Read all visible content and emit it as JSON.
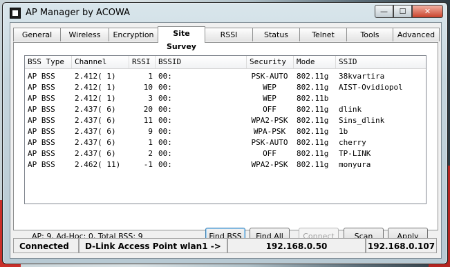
{
  "window": {
    "title": "AP Manager by ACOWA",
    "min": "—",
    "max": "☐",
    "close": "✕"
  },
  "tabs": [
    {
      "label": "General"
    },
    {
      "label": "Wireless"
    },
    {
      "label": "Encryption"
    },
    {
      "label": "Site Survey"
    },
    {
      "label": "RSSI"
    },
    {
      "label": "Status"
    },
    {
      "label": "Telnet"
    },
    {
      "label": "Tools"
    },
    {
      "label": "Advanced"
    }
  ],
  "columns": [
    "BSS Type",
    "Channel",
    "RSSI",
    "BSSID",
    "Security",
    "Mode",
    "SSID"
  ],
  "rows": [
    {
      "type": "AP BSS",
      "channel": "2.412( 1)",
      "rssi": "1",
      "bssid": "00:",
      "security": "PSK-AUTO",
      "mode": "802.11g",
      "ssid": "38kvartira"
    },
    {
      "type": "AP BSS",
      "channel": "2.412( 1)",
      "rssi": "10",
      "bssid": "00:",
      "security": "WEP",
      "mode": "802.11g",
      "ssid": "AIST-Ovidiopol"
    },
    {
      "type": "AP BSS",
      "channel": "2.412( 1)",
      "rssi": "3",
      "bssid": "00:",
      "security": "WEP",
      "mode": "802.11b",
      "ssid": ""
    },
    {
      "type": "AP BSS",
      "channel": "2.437( 6)",
      "rssi": "20",
      "bssid": "00:",
      "security": "OFF",
      "mode": "802.11g",
      "ssid": "dlink"
    },
    {
      "type": "AP BSS",
      "channel": "2.437( 6)",
      "rssi": "11",
      "bssid": "00:",
      "security": "WPA2-PSK",
      "mode": "802.11g",
      "ssid": "Sins_dlink"
    },
    {
      "type": "AP BSS",
      "channel": "2.437( 6)",
      "rssi": "9",
      "bssid": "00:",
      "security": "WPA-PSK",
      "mode": "802.11g",
      "ssid": "1b"
    },
    {
      "type": "AP BSS",
      "channel": "2.437( 6)",
      "rssi": "1",
      "bssid": "00:",
      "security": "PSK-AUTO",
      "mode": "802.11g",
      "ssid": "cherry"
    },
    {
      "type": "AP BSS",
      "channel": "2.437( 6)",
      "rssi": "2",
      "bssid": "00:",
      "security": "OFF",
      "mode": "802.11g",
      "ssid": "TP-LINK"
    },
    {
      "type": "AP BSS",
      "channel": "2.462( 11)",
      "rssi": "-1",
      "bssid": "00:",
      "security": "WPA2-PSK",
      "mode": "802.11g",
      "ssid": "monyura"
    }
  ],
  "summary": "AP: 9, Ad-Hoc: 0, Total BSS: 9",
  "buttons": {
    "find_bss": "Find BSS",
    "find_all": "Find All",
    "connect": "Connect",
    "scan": "Scan",
    "apply": "Apply"
  },
  "statusbar": {
    "state": "Connected",
    "device": "D-Link Access Point wlan1 ->",
    "ap_ip": "192.168.0.50",
    "local_ip": "192.168.0.107"
  }
}
